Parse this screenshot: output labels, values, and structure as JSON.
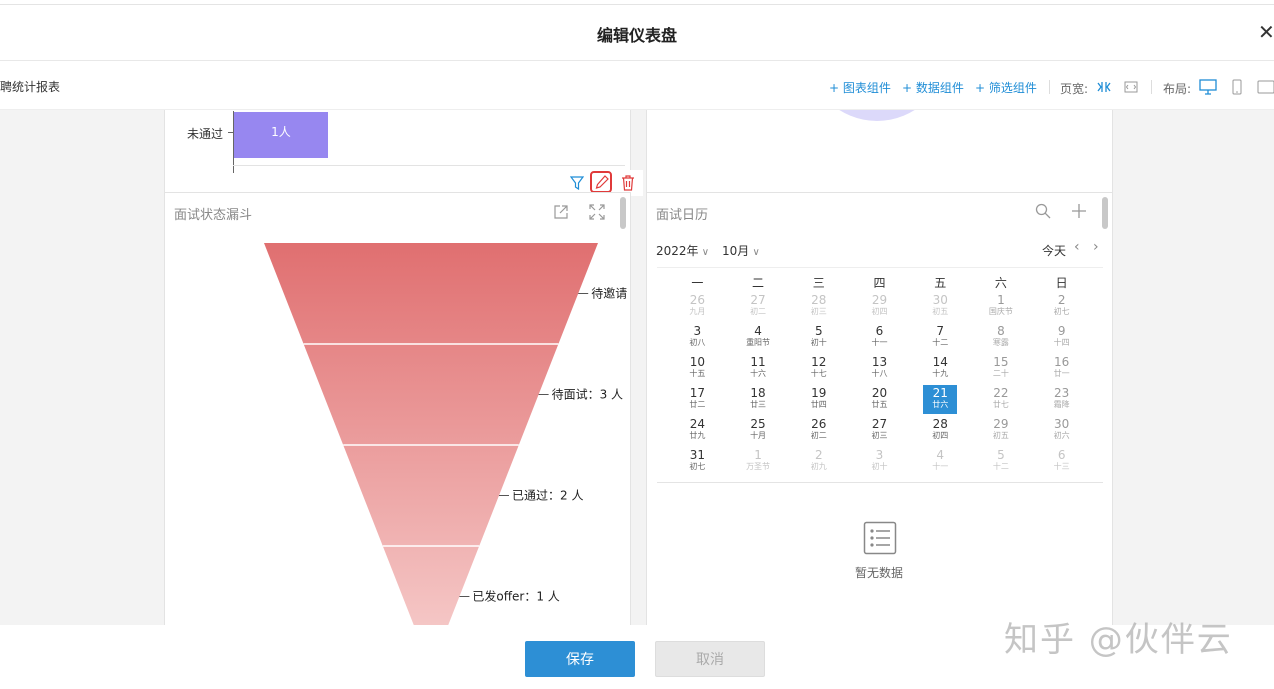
{
  "dialog": {
    "title": "编辑仪表盘"
  },
  "header": {
    "report_name": "招聘统计报表"
  },
  "toolbar": {
    "add_chart": "+ 图表组件",
    "add_data": "+ 数据组件",
    "add_filter": "+ 筛选组件",
    "page_width_label": "页宽:",
    "layout_label": "布局:"
  },
  "top_left_chart": {
    "category_label": "未通过",
    "bar_label": "1人",
    "bar_color": "#9787f0"
  },
  "funnel_card": {
    "title": "面试状态漏斗",
    "colors": {
      "top": "#e06f70",
      "bottom": "#f7d0cf"
    },
    "chart_data": {
      "type": "funnel",
      "stages": [
        {
          "label": "待邀请"
        },
        {
          "label": "待面试：3 人",
          "value": 3
        },
        {
          "label": "已通过：2 人",
          "value": 2
        },
        {
          "label": "已发offer：1 人",
          "value": 1
        }
      ]
    }
  },
  "calendar_card": {
    "title": "面试日历",
    "year": "2022年",
    "month": "10月",
    "today_button": "今天",
    "weekdays": [
      "一",
      "二",
      "三",
      "四",
      "五",
      "六",
      "日"
    ],
    "selected_day": "21",
    "empty_text": "暂无数据",
    "weeks": [
      [
        {
          "n": "26",
          "l": "九月",
          "s": "other"
        },
        {
          "n": "27",
          "l": "初二",
          "s": "other"
        },
        {
          "n": "28",
          "l": "初三",
          "s": "other"
        },
        {
          "n": "29",
          "l": "初四",
          "s": "other"
        },
        {
          "n": "30",
          "l": "初五",
          "s": "other"
        },
        {
          "n": "1",
          "l": "国庆节",
          "s": "weekend"
        },
        {
          "n": "2",
          "l": "初七",
          "s": "weekend"
        }
      ],
      [
        {
          "n": "3",
          "l": "初八",
          "s": "cur"
        },
        {
          "n": "4",
          "l": "重阳节",
          "s": "cur"
        },
        {
          "n": "5",
          "l": "初十",
          "s": "cur"
        },
        {
          "n": "6",
          "l": "十一",
          "s": "cur"
        },
        {
          "n": "7",
          "l": "十二",
          "s": "cur"
        },
        {
          "n": "8",
          "l": "寒露",
          "s": "weekend"
        },
        {
          "n": "9",
          "l": "十四",
          "s": "weekend"
        }
      ],
      [
        {
          "n": "10",
          "l": "十五",
          "s": "cur"
        },
        {
          "n": "11",
          "l": "十六",
          "s": "cur"
        },
        {
          "n": "12",
          "l": "十七",
          "s": "cur"
        },
        {
          "n": "13",
          "l": "十八",
          "s": "cur"
        },
        {
          "n": "14",
          "l": "十九",
          "s": "cur"
        },
        {
          "n": "15",
          "l": "二十",
          "s": "weekend"
        },
        {
          "n": "16",
          "l": "廿一",
          "s": "weekend"
        }
      ],
      [
        {
          "n": "17",
          "l": "廿二",
          "s": "cur"
        },
        {
          "n": "18",
          "l": "廿三",
          "s": "cur"
        },
        {
          "n": "19",
          "l": "廿四",
          "s": "cur"
        },
        {
          "n": "20",
          "l": "廿五",
          "s": "cur"
        },
        {
          "n": "21",
          "l": "廿六",
          "s": "selected"
        },
        {
          "n": "22",
          "l": "廿七",
          "s": "weekend"
        },
        {
          "n": "23",
          "l": "霜降",
          "s": "weekend"
        }
      ],
      [
        {
          "n": "24",
          "l": "廿九",
          "s": "cur"
        },
        {
          "n": "25",
          "l": "十月",
          "s": "cur"
        },
        {
          "n": "26",
          "l": "初二",
          "s": "cur"
        },
        {
          "n": "27",
          "l": "初三",
          "s": "cur"
        },
        {
          "n": "28",
          "l": "初四",
          "s": "cur"
        },
        {
          "n": "29",
          "l": "初五",
          "s": "weekend"
        },
        {
          "n": "30",
          "l": "初六",
          "s": "weekend"
        }
      ],
      [
        {
          "n": "31",
          "l": "初七",
          "s": "cur"
        },
        {
          "n": "1",
          "l": "万圣节",
          "s": "other"
        },
        {
          "n": "2",
          "l": "初九",
          "s": "other"
        },
        {
          "n": "3",
          "l": "初十",
          "s": "other"
        },
        {
          "n": "4",
          "l": "十一",
          "s": "other"
        },
        {
          "n": "5",
          "l": "十二",
          "s": "other"
        },
        {
          "n": "6",
          "l": "十三",
          "s": "other"
        }
      ]
    ]
  },
  "footer": {
    "save": "保存",
    "cancel": "取消"
  },
  "watermark": "知乎 @伙伴云",
  "theme": {
    "accent": "#2d8fd5",
    "danger": "#e03a3a"
  }
}
